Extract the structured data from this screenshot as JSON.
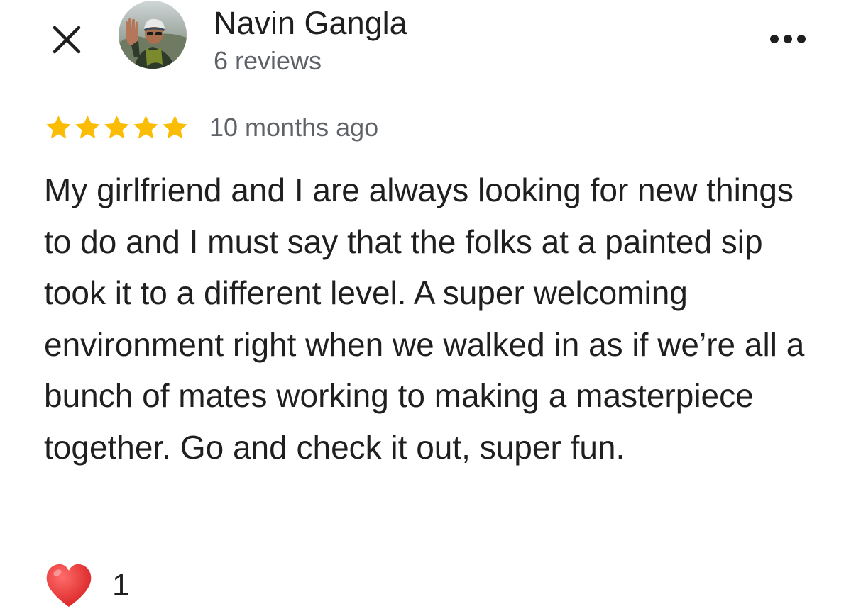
{
  "header": {
    "close_icon": "close-icon",
    "avatar_icon": "avatar-photo",
    "reviewer_name": "Navin Gangla",
    "review_count": "6 reviews",
    "more_icon": "more-horizontal-icon"
  },
  "review": {
    "rating": 5,
    "rating_max": 5,
    "star_color": "#fbbc04",
    "date": "10 months ago",
    "text": "My girlfriend and I are always looking for new things to do and I must say that the folks at a painted sip took it to a different level. A super welcoming environment right when we walked in as if we’re all a bunch of mates working to making a masterpiece together. Go and check it out, super fun."
  },
  "reactions": {
    "icon": "heart-icon",
    "heart_color": "#e3342f",
    "count": "1"
  }
}
